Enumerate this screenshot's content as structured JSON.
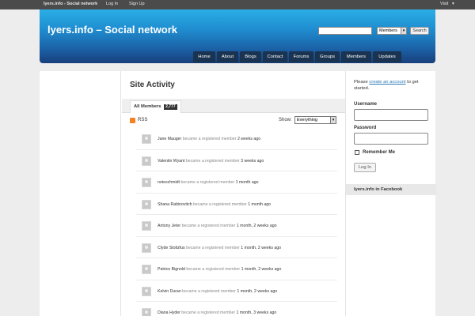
{
  "adminbar": {
    "site": "lyers.info - Social network",
    "login": "Log In",
    "signup": "Sign Up",
    "visit": "Visit",
    "visit_caret": "▾"
  },
  "header": {
    "title": "lyers.info – Social network",
    "search_value": "",
    "search_scope": "Members",
    "search_button": "Search"
  },
  "nav": {
    "tabs": [
      "Home",
      "About",
      "Blogs",
      "Contact",
      "Forums",
      "Groups",
      "Members",
      "Updates"
    ]
  },
  "content": {
    "title": "Site Activity",
    "tab_label": "All Members",
    "tab_count": "2,777",
    "rss": "RSS",
    "show_label": "Show:",
    "show_value": "Everything",
    "activity": [
      {
        "name": "Jane Mauger",
        "verb": "became a registered member",
        "time": "2 weeks ago"
      },
      {
        "name": "Valentin Wyant",
        "verb": "became a registered member",
        "time": "3 weeks ago"
      },
      {
        "name": "noteschmidt",
        "verb": "became a registered member",
        "time": "1 month ago"
      },
      {
        "name": "Shana Rabinovitch",
        "verb": "became a registered member",
        "time": "1 month ago"
      },
      {
        "name": "Antony Jeter",
        "verb": "became a registered member",
        "time": "1 month, 2 weeks ago"
      },
      {
        "name": "Clyde Stoltzfus",
        "verb": "became a registered member",
        "time": "1 month, 2 weeks ago"
      },
      {
        "name": "Patrice Bignold",
        "verb": "became a registered member",
        "time": "1 month, 2 weeks ago"
      },
      {
        "name": "Kelvin Duran",
        "verb": "became a registered member",
        "time": "1 month, 2 weeks ago"
      },
      {
        "name": "Diana Hyder",
        "verb": "became a registered member",
        "time": "1 month, 3 weeks ago"
      }
    ]
  },
  "sidebar": {
    "intro_prefix": "Please",
    "intro_link": "create an account",
    "intro_suffix": "to get started.",
    "username_label": "Username",
    "password_label": "Password",
    "remember_label": "Remember Me",
    "login_button": "Log In",
    "facebook_heading": "lyers.info in Facebook"
  }
}
